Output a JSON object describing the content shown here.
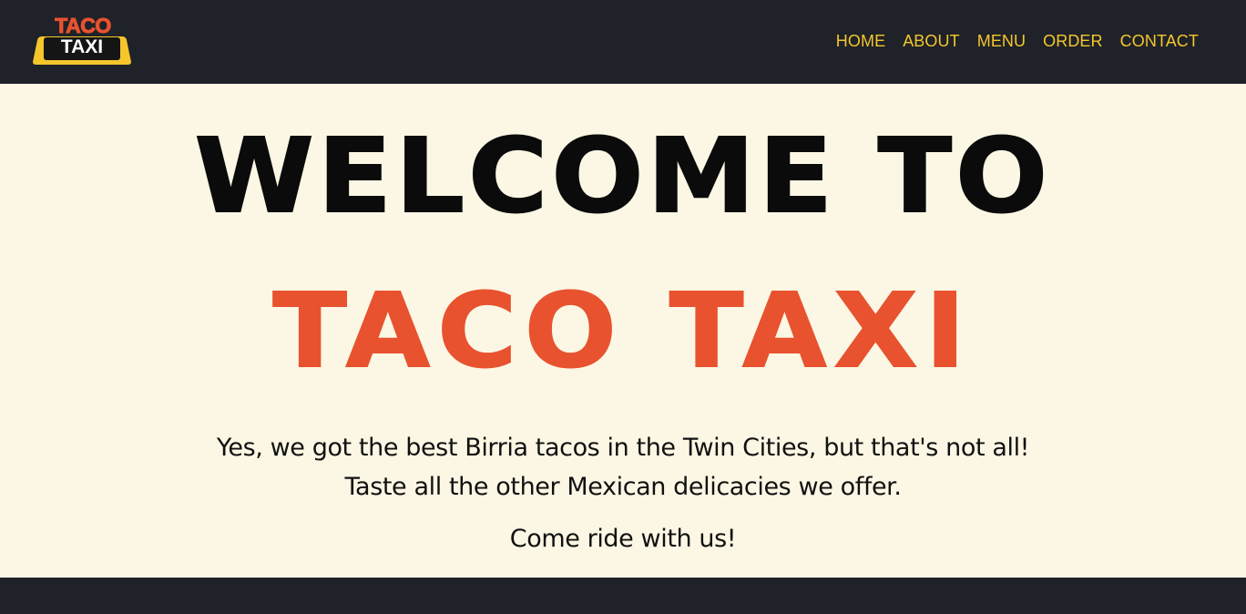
{
  "colors": {
    "nav_bg": "#1f2229",
    "nav_link": "#f5c62b",
    "hero_bg": "#fcf7e4",
    "accent": "#e8522f",
    "text": "#111111"
  },
  "logo": {
    "top_text": "TACO",
    "bottom_text": "TAXI"
  },
  "nav": {
    "items": [
      {
        "label": "HOME"
      },
      {
        "label": "ABOUT"
      },
      {
        "label": "MENU"
      },
      {
        "label": "ORDER"
      },
      {
        "label": "CONTACT"
      }
    ]
  },
  "hero": {
    "headline_line1": "WELCOME TO",
    "headline_line2": "TACO TAXI",
    "tagline_line1": "Yes, we got the best Birria tacos in the Twin Cities, but that's not all!",
    "tagline_line2": "Taste all the other Mexican delicacies we offer.",
    "cta": "Come ride with us!"
  }
}
